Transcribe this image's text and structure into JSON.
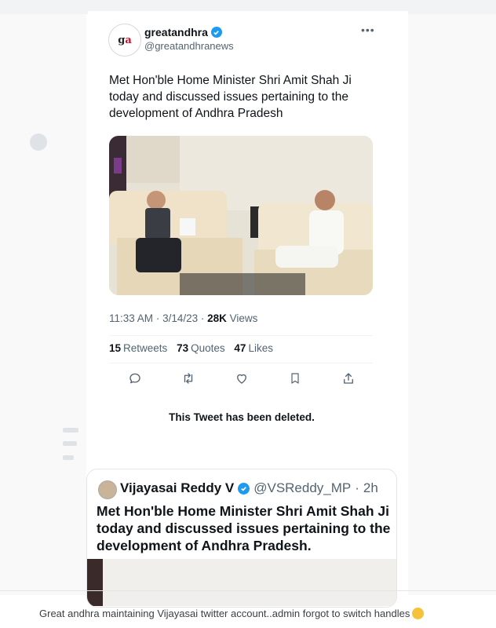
{
  "tweet": {
    "name": "greatandhra",
    "handle": "@greatandhranews",
    "text": "Met Hon'ble Home Minister Shri Amit Shah Ji today and discussed issues pertaining to the development of Andhra Pradesh",
    "time": "11:33 AM",
    "date": "3/14/23",
    "views_count": "28K",
    "views_label": "Views",
    "retweets_count": "15",
    "retweets_label": "Retweets",
    "quotes_count": "73",
    "quotes_label": "Quotes",
    "likes_count": "47",
    "likes_label": "Likes",
    "more_label": "•••"
  },
  "deleted_notice": "This Tweet has been deleted.",
  "quoted": {
    "name": "Vijayasai Reddy V",
    "handle": "@VSReddy_MP",
    "age": "2h",
    "text": "Met Hon'ble Home Minister Shri Amit Shah Ji today and discussed issues pertaining to the development of Andhra Pradesh."
  },
  "caption": "Great andhra maintaining Vijayasai twitter account..admin forgot to switch handles",
  "colors": {
    "verified": "#1d9bf0",
    "text": "#0f1419",
    "secondary": "#536471"
  },
  "icons": [
    "reply-icon",
    "retweet-icon",
    "like-icon",
    "bookmark-icon",
    "share-icon",
    "verified-icon",
    "more-icon",
    "laughing-emoji-icon"
  ]
}
